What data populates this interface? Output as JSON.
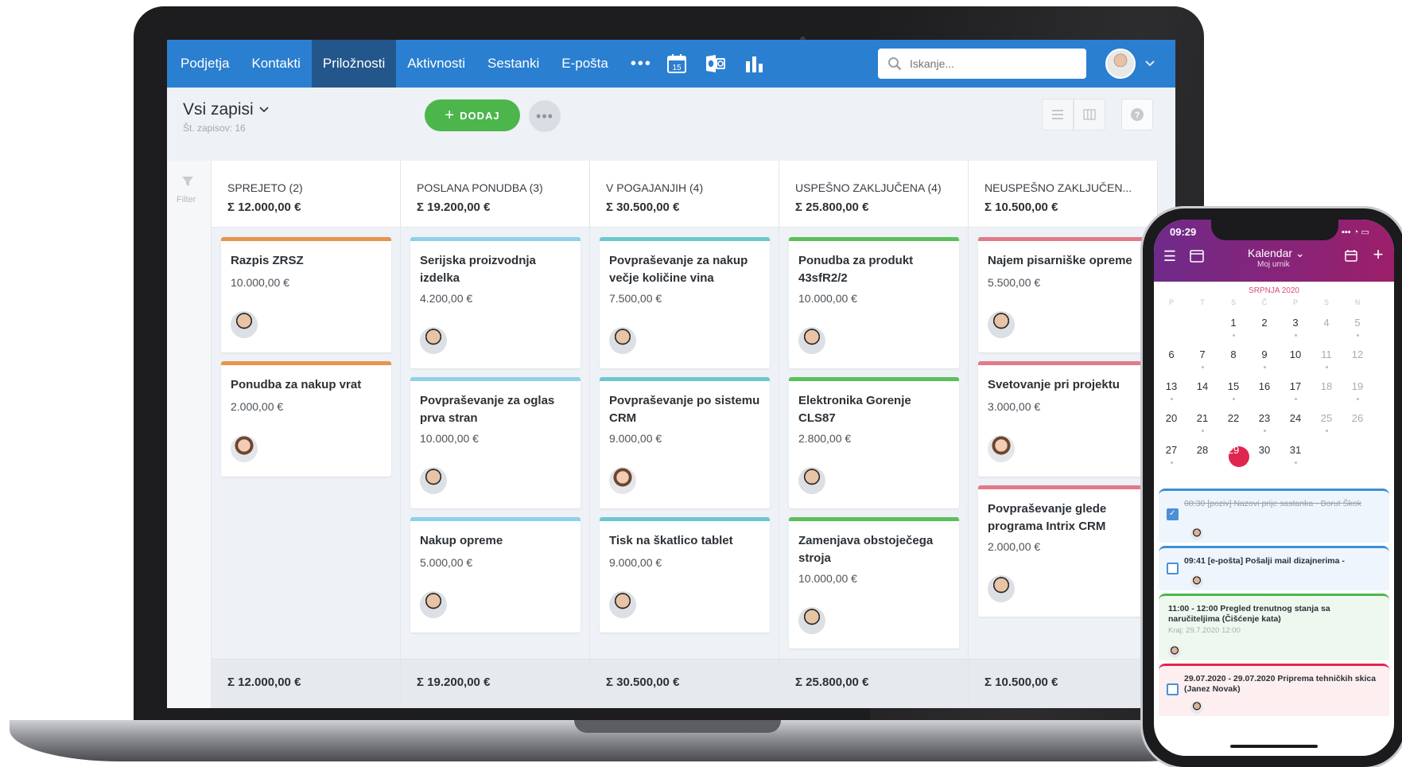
{
  "nav": {
    "tabs": [
      {
        "label": "Podjetja"
      },
      {
        "label": "Kontakti"
      },
      {
        "label": "Priložnosti"
      },
      {
        "label": "Aktivnosti"
      },
      {
        "label": "Sestanki"
      },
      {
        "label": "E-pošta"
      }
    ],
    "active_tab": "Priložnosti",
    "more_label": "•••",
    "calendar_icon_day": "15",
    "search_placeholder": "Iskanje...",
    "icons": [
      "calendar-icon",
      "outlook-icon",
      "bar-chart-icon",
      "search-icon",
      "chevron-down-icon"
    ]
  },
  "toolbar": {
    "view_title": "Vsi zapisi",
    "record_count": "Št. zapisov: 16",
    "add_label": "DODAJ",
    "more_label": "•••"
  },
  "filter": {
    "label": "Filter"
  },
  "columns": [
    {
      "title": "SPREJETO (2)",
      "sum": "Σ 12.000,00 €",
      "footer_sum": "Σ 12.000,00 €",
      "color": "#e8944c",
      "cards": [
        {
          "title": "Razpis ZRSZ",
          "value": "10.000,00 €",
          "avatar": "male"
        },
        {
          "title": "Ponudba za nakup vrat",
          "value": "2.000,00 €",
          "avatar": "female"
        }
      ]
    },
    {
      "title": "POSLANA PONUDBA (3)",
      "sum": "Σ 19.200,00 €",
      "footer_sum": "Σ 19.200,00 €",
      "color": "#8fd0ea",
      "cards": [
        {
          "title": "Serijska proizvodnja izdelka",
          "value": "4.200,00 €",
          "avatar": "male"
        },
        {
          "title": "Povpraševanje za oglas prva stran",
          "value": "10.000,00 €",
          "avatar": "male"
        },
        {
          "title": "Nakup opreme",
          "value": "5.000,00 €",
          "avatar": "male"
        }
      ]
    },
    {
      "title": "V POGAJANJIH (4)",
      "sum": "Σ 30.500,00 €",
      "footer_sum": "Σ 30.500,00 €",
      "color": "#6cc7cf",
      "cards": [
        {
          "title": "Povpraševanje za nakup večje količine vina",
          "value": "7.500,00 €",
          "avatar": "male"
        },
        {
          "title": "Povpraševanje po sistemu CRM",
          "value": "9.000,00 €",
          "avatar": "female"
        },
        {
          "title": "Tisk na škatlico tablet",
          "value": "9.000,00 €",
          "avatar": "male"
        }
      ]
    },
    {
      "title": "USPEŠNO ZAKLJUČENA (4)",
      "sum": "Σ 25.800,00 €",
      "footer_sum": "Σ 25.800,00 €",
      "color": "#5cbf5c",
      "cards": [
        {
          "title": "Ponudba za produkt 43sfR2/2",
          "value": "10.000,00 €",
          "avatar": "male"
        },
        {
          "title": "Elektronika Gorenje CLS87",
          "value": "2.800,00 €",
          "avatar": "male"
        },
        {
          "title": "Zamenjava obstoječega stroja",
          "value": "10.000,00 €",
          "avatar": "male"
        }
      ]
    },
    {
      "title": "NEUSPEŠNO ZAKLJUČEN...",
      "sum": "Σ 10.500,00 €",
      "footer_sum": "Σ 10.500,00 €",
      "color": "#e27a8a",
      "cards": [
        {
          "title": "Najem pisarniške opreme",
          "value": "5.500,00 €",
          "avatar": "male"
        },
        {
          "title": "Svetovanje pri projektu",
          "value": "3.000,00 €",
          "avatar": "female"
        },
        {
          "title": "Povpraševanje glede programa Intrix CRM",
          "value": "2.000,00 €",
          "avatar": "male"
        }
      ]
    }
  ],
  "phone": {
    "time": "09:29",
    "status": "▪▪▪ ◔ ▭",
    "title": "Kalendar ⌄",
    "subtitle": "Moj urnik",
    "month": "SRPNJA 2020",
    "weekdays": [
      "P",
      "T",
      "S",
      "Č",
      "P",
      "S",
      "N"
    ],
    "weeks": [
      [
        "",
        "",
        "1",
        "2",
        "3",
        "4",
        "5"
      ],
      [
        "6",
        "7",
        "8",
        "9",
        "10",
        "11",
        "12"
      ],
      [
        "13",
        "14",
        "15",
        "16",
        "17",
        "18",
        "19"
      ],
      [
        "20",
        "21",
        "22",
        "23",
        "24",
        "25",
        "26"
      ],
      [
        "27",
        "28",
        "29",
        "30",
        "31",
        "",
        ""
      ]
    ],
    "today": "29",
    "agenda": [
      {
        "text": "08:30 [poziv] Nazovi prije sastanka - Borut Škok",
        "done": true,
        "color": "#3b8fd8",
        "bg": "#eef5fc"
      },
      {
        "text": "09:41 [e-pošta] Pošalji mail dizajnerima -",
        "done": false,
        "color": "#3b8fd8",
        "bg": "#eef5fc"
      },
      {
        "text": "11:00 - 12:00 Pregled trenutnog stanja sa naručiteljima (Čišćenje kata)",
        "sub": "Kraj: 29.7.2020 12:00",
        "done": false,
        "color": "#4cb54c",
        "bg": "#eef8ee"
      },
      {
        "text": "29.07.2020 - 29.07.2020 Priprema tehničkih skica (Janez Novak)",
        "done": false,
        "color": "#e0264f",
        "bg": "#fdeef0"
      }
    ]
  }
}
